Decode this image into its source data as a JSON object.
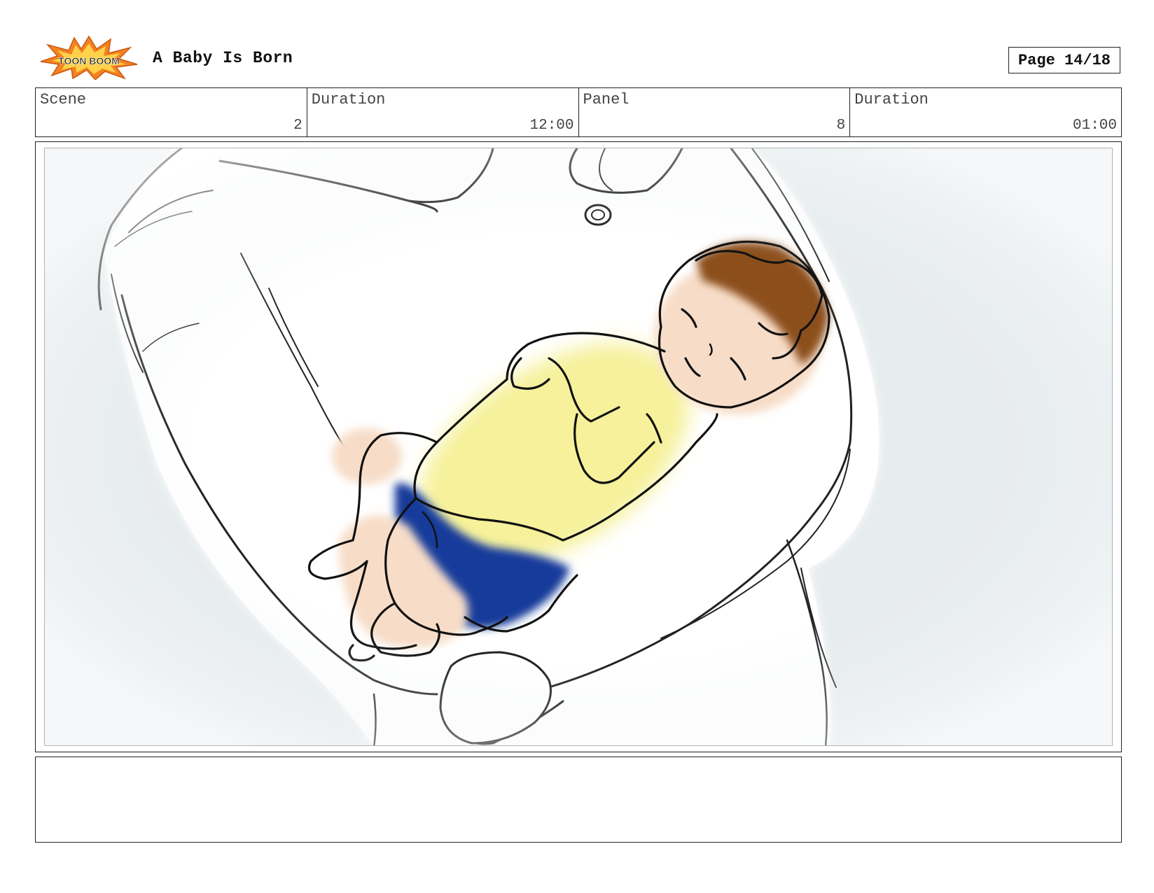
{
  "header": {
    "logo_text": "TOON BOOM",
    "title": "A Baby Is Born",
    "page_label": "Page 14/18"
  },
  "info": {
    "scene_label": "Scene",
    "scene_value": "2",
    "scene_duration_label": "Duration",
    "scene_duration_value": "12:00",
    "panel_label": "Panel",
    "panel_value": "8",
    "panel_duration_label": "Duration",
    "panel_duration_value": "01:00"
  },
  "notes": {
    "text": ""
  },
  "colors": {
    "background_wash": "#e7ecee",
    "baby_shirt": "#f6f19a",
    "baby_diaper": "#143a9a",
    "baby_skin": "#f7ddc8",
    "baby_hair": "#8c4f1c",
    "logo_burst": "#f58220"
  }
}
